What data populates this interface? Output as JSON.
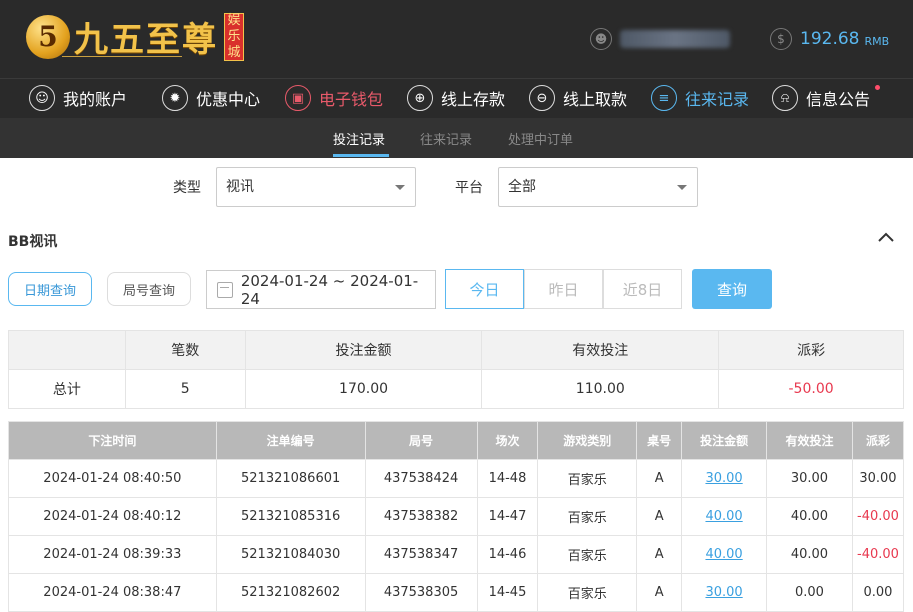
{
  "brand": {
    "logo_glyph": "5",
    "name": "九五至尊",
    "badge_chars": [
      "娱",
      "乐",
      "城"
    ]
  },
  "account": {
    "balance": "192.68",
    "unit": "RMB",
    "user_icon": "user-circle-icon",
    "money_icon": "dollar-circle-icon"
  },
  "nav": [
    {
      "label": "我的账户",
      "icon": "user-icon",
      "glyph": "☺"
    },
    {
      "label": "优惠中心",
      "icon": "gift-icon",
      "glyph": "✹"
    },
    {
      "label": "电子钱包",
      "icon": "wallet-icon",
      "glyph": "▣"
    },
    {
      "label": "线上存款",
      "icon": "deposit-icon",
      "glyph": "⊕"
    },
    {
      "label": "线上取款",
      "icon": "withdraw-icon",
      "glyph": "⊖"
    },
    {
      "label": "往来记录",
      "icon": "records-icon",
      "glyph": "≡"
    },
    {
      "label": "信息公告",
      "icon": "bell-icon",
      "glyph": "⍾"
    }
  ],
  "subnav": [
    "投注记录",
    "往来记录",
    "处理中订单"
  ],
  "filters": {
    "type_label": "类型",
    "type_value": "视讯",
    "platform_label": "平台",
    "platform_value": "全部"
  },
  "section": {
    "title": "BB视讯"
  },
  "query": {
    "date_tab": "日期查询",
    "round_tab": "局号查询",
    "date_range": "2024-01-24 ~ 2024-01-24",
    "quick": [
      "今日",
      "昨日",
      "近8日"
    ],
    "submit": "查询"
  },
  "summary": {
    "headers": [
      "",
      "笔数",
      "投注金额",
      "有效投注",
      "派彩"
    ],
    "row": [
      "总计",
      "5",
      "170.00",
      "110.00",
      "-50.00"
    ]
  },
  "details": {
    "headers": [
      "下注时间",
      "注单编号",
      "局号",
      "场次",
      "游戏类别",
      "桌号",
      "投注金额",
      "有效投注",
      "派彩"
    ],
    "rows": [
      [
        "2024-01-24 08:40:50",
        "521321086601",
        "437538424",
        "14-48",
        "百家乐",
        "A",
        "30.00",
        "30.00",
        "30.00"
      ],
      [
        "2024-01-24 08:40:12",
        "521321085316",
        "437538382",
        "14-47",
        "百家乐",
        "A",
        "40.00",
        "40.00",
        "-40.00"
      ],
      [
        "2024-01-24 08:39:33",
        "521321084030",
        "437538347",
        "14-46",
        "百家乐",
        "A",
        "40.00",
        "40.00",
        "-40.00"
      ],
      [
        "2024-01-24 08:38:47",
        "521321082602",
        "437538305",
        "14-45",
        "百家乐",
        "A",
        "30.00",
        "0.00",
        "0.00"
      ]
    ]
  },
  "colors": {
    "accent": "#5ab8f0",
    "negative": "#e8394f",
    "wallet": "#e85a6a",
    "header_bg": "#2a2a2a"
  }
}
